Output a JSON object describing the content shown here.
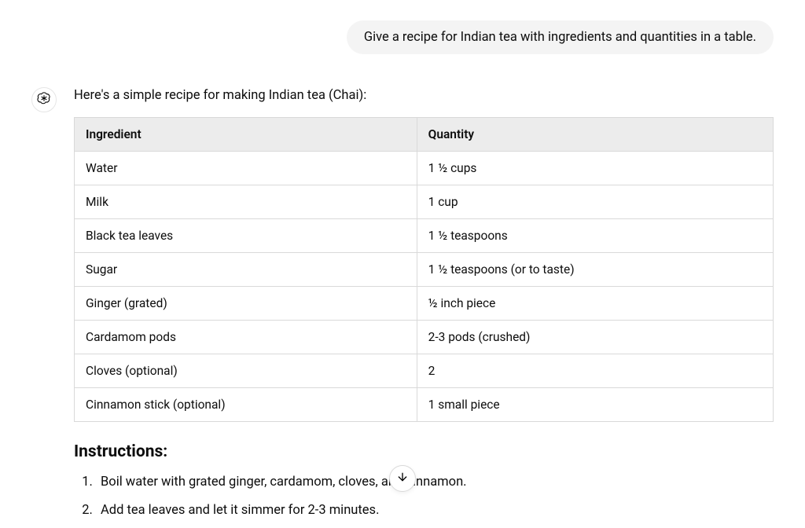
{
  "user": {
    "message": "Give a recipe for Indian tea with ingredients and quantities in a table."
  },
  "assistant": {
    "intro": "Here's a simple recipe for making Indian tea (Chai):",
    "table": {
      "headers": {
        "ingredient": "Ingredient",
        "quantity": "Quantity"
      },
      "rows": [
        {
          "ingredient": "Water",
          "quantity": "1 ½ cups"
        },
        {
          "ingredient": "Milk",
          "quantity": "1 cup"
        },
        {
          "ingredient": "Black tea leaves",
          "quantity": "1 ½ teaspoons"
        },
        {
          "ingredient": "Sugar",
          "quantity": "1 ½ teaspoons (or to taste)"
        },
        {
          "ingredient": "Ginger (grated)",
          "quantity": "½ inch piece"
        },
        {
          "ingredient": "Cardamom pods",
          "quantity": "2-3 pods (crushed)"
        },
        {
          "ingredient": "Cloves (optional)",
          "quantity": "2"
        },
        {
          "ingredient": "Cinnamon stick (optional)",
          "quantity": "1 small piece"
        }
      ]
    },
    "instructions_heading": "Instructions:",
    "instructions": [
      "Boil water with grated ginger, cardamom, cloves, and cinnamon.",
      "Add tea leaves and let it simmer for 2-3 minutes."
    ]
  },
  "icons": {
    "avatar": "openai-logo",
    "scroll": "arrow-down"
  }
}
